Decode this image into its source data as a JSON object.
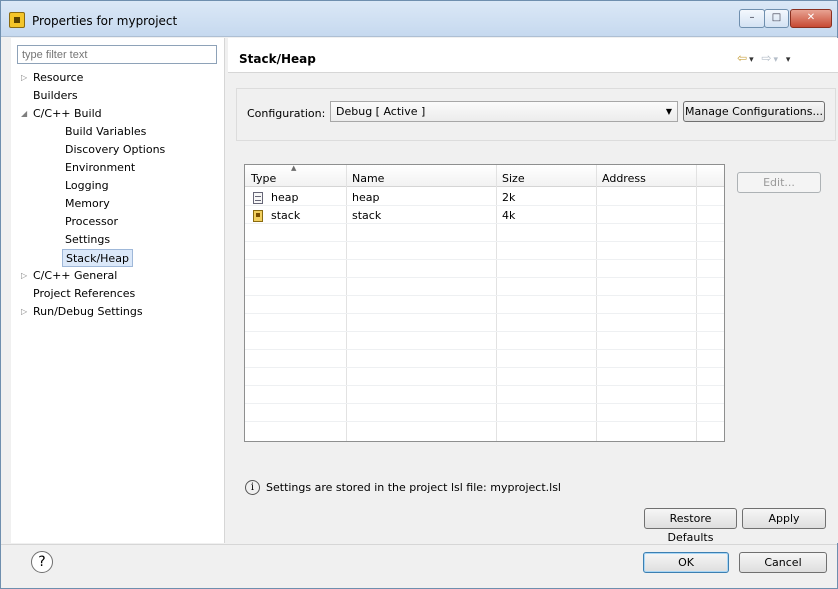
{
  "window": {
    "title": "Properties for myproject",
    "controls": {
      "minimize": "–",
      "maximize": "□",
      "close": "✕"
    }
  },
  "left_panel": {
    "filter_placeholder": "type filter text",
    "tree": [
      {
        "label": "Resource",
        "twisty": "▷"
      },
      {
        "label": "Builders",
        "twisty": ""
      },
      {
        "label": "C/C++ Build",
        "twisty": "◢"
      },
      {
        "label": "Build Variables",
        "twisty": ""
      },
      {
        "label": "Discovery Options",
        "twisty": ""
      },
      {
        "label": "Environment",
        "twisty": ""
      },
      {
        "label": "Logging",
        "twisty": ""
      },
      {
        "label": "Memory",
        "twisty": ""
      },
      {
        "label": "Processor",
        "twisty": ""
      },
      {
        "label": "Settings",
        "twisty": ""
      },
      {
        "label": "Stack/Heap",
        "twisty": ""
      },
      {
        "label": "C/C++ General",
        "twisty": "▷"
      },
      {
        "label": "Project References",
        "twisty": ""
      },
      {
        "label": "Run/Debug Settings",
        "twisty": "▷"
      }
    ],
    "selected": "Stack/Heap"
  },
  "right_panel": {
    "title": "Stack/Heap",
    "nav": {
      "back": "⇦",
      "back_menu": "▾",
      "forward": "⇨",
      "forward_menu": "▾",
      "view_menu": "▾"
    },
    "configuration": {
      "label": "Configuration:",
      "value": "Debug  [ Active ]",
      "dropdown_arrow": "▼",
      "manage_button": "Manage Configurations..."
    },
    "table": {
      "headers": [
        "Type",
        "Name",
        "Size",
        "Address"
      ],
      "sort_indicator": "▲",
      "rows": [
        {
          "type": "heap",
          "name": "heap",
          "size": "2k",
          "address": "",
          "icon": "heap-icon"
        },
        {
          "type": "stack",
          "name": "stack",
          "size": "4k",
          "address": "",
          "icon": "stack-icon"
        }
      ]
    },
    "edit_button": "Edit...",
    "info_text": "Settings are stored in the project lsl file: myproject.lsl",
    "info_icon": "i",
    "restore_defaults_button": "Restore Defaults",
    "apply_button": "Apply"
  },
  "footer": {
    "help_icon": "?",
    "ok_button": "OK",
    "cancel_button": "Cancel"
  }
}
